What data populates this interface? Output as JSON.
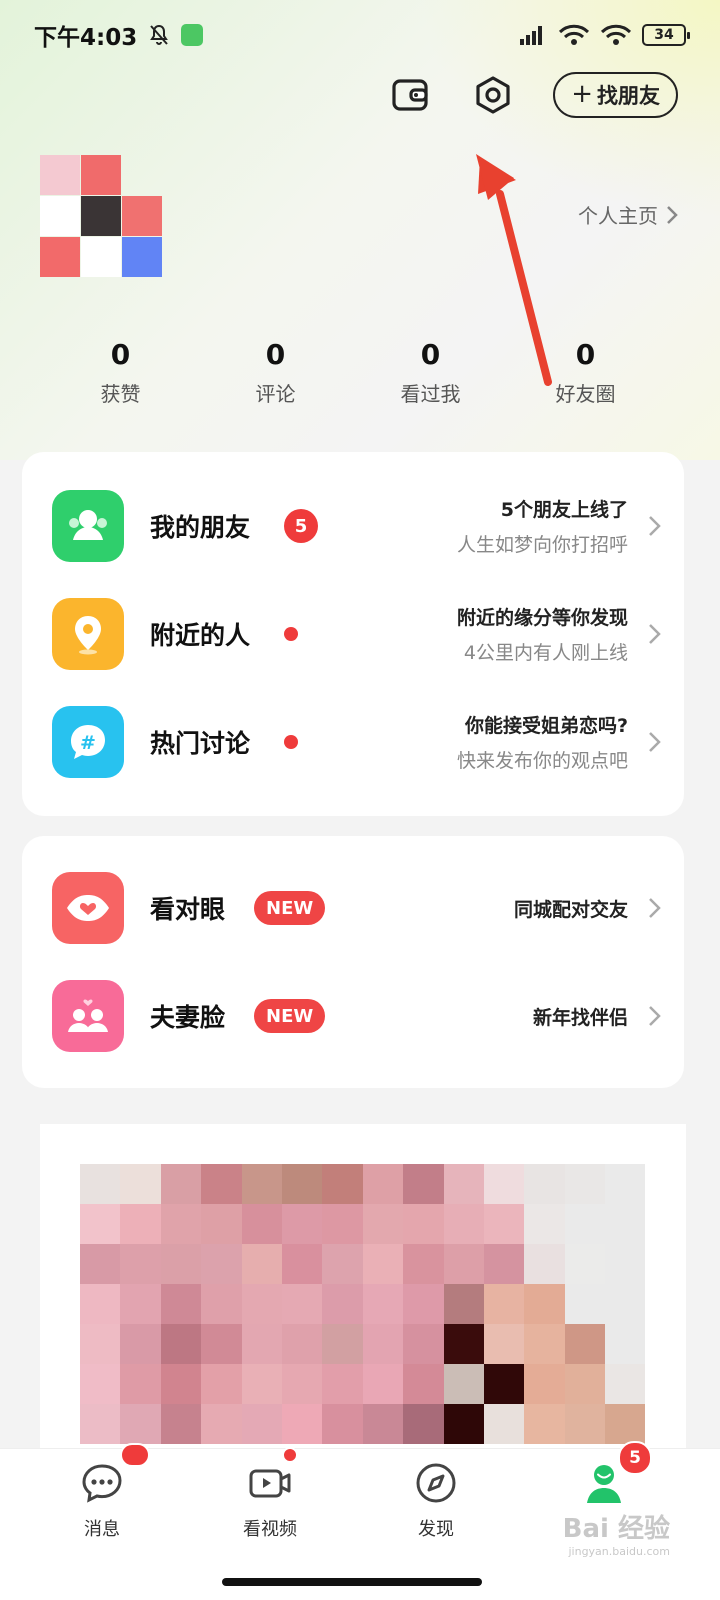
{
  "status_bar": {
    "time": "下午4:03",
    "battery": "34"
  },
  "header": {
    "find_friend_label": "找朋友",
    "profile_link_label": "个人主页"
  },
  "stats": [
    {
      "value": "0",
      "label": "获赞"
    },
    {
      "value": "0",
      "label": "评论"
    },
    {
      "value": "0",
      "label": "看过我"
    },
    {
      "value": "0",
      "label": "好友圈"
    }
  ],
  "social_card": {
    "items": [
      {
        "title": "我的朋友",
        "badge": "5",
        "line1": "5个朋友上线了",
        "line2": "人生如梦向你打招呼",
        "icon": "friends-icon",
        "color": "#2fcf6c"
      },
      {
        "title": "附近的人",
        "line1": "附近的缘分等你发现",
        "line2": "4公里内有人刚上线",
        "icon": "location-pin-icon",
        "color": "#fbb52d"
      },
      {
        "title": "热门讨论",
        "line1": "你能接受姐弟恋吗?",
        "line2": "快来发布你的观点吧",
        "icon": "hashtag-chat-icon",
        "color": "#28c2ef"
      }
    ]
  },
  "match_card": {
    "items": [
      {
        "title": "看对眼",
        "tag": "NEW",
        "line1": "同城配对交友",
        "icon": "eye-heart-icon",
        "color": "#f76464"
      },
      {
        "title": "夫妻脸",
        "tag": "NEW",
        "line1": "新年找伴侣",
        "icon": "couple-icon",
        "color": "#f86b98"
      }
    ]
  },
  "tabbar": {
    "tabs": [
      {
        "label": "消息",
        "icon": "message-bubble-icon"
      },
      {
        "label": "看视频",
        "icon": "video-icon"
      },
      {
        "label": "发现",
        "icon": "compass-icon"
      },
      {
        "label": "",
        "icon": "profile-icon"
      }
    ],
    "profile_badge": "5"
  },
  "watermark": {
    "text": "Bai 经验",
    "sub": "jingyan.baidu.com"
  },
  "colors": {
    "accent_red": "#ef3b3b",
    "primary_green": "#2fcf6c",
    "annotation_arrow": "#e8412f"
  }
}
